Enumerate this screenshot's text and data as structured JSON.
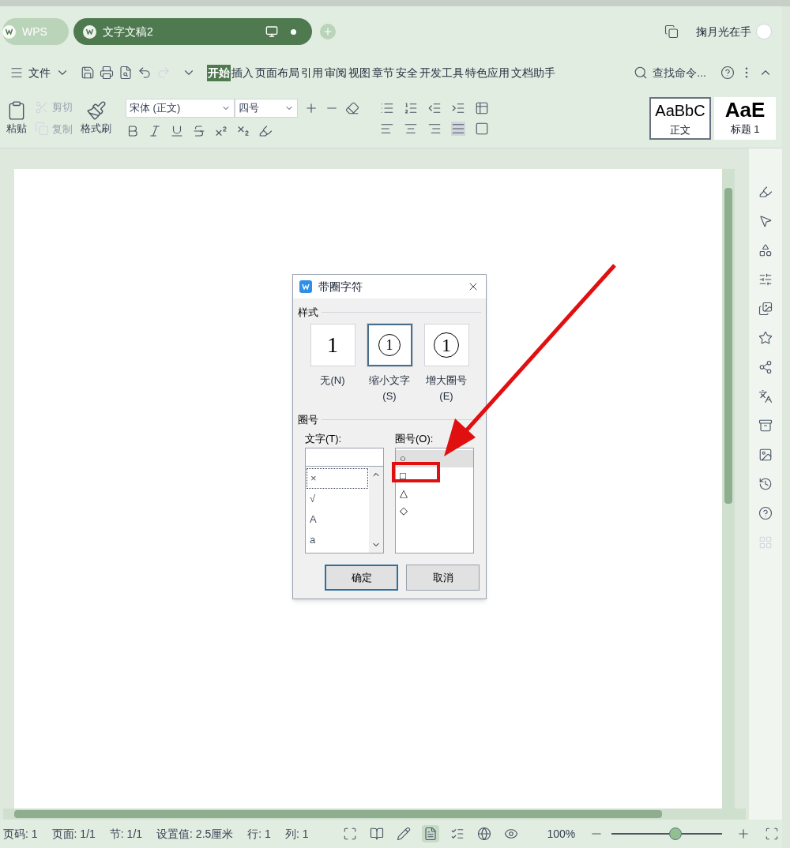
{
  "app_tabs": [
    {
      "label": "WPS",
      "selected": false
    },
    {
      "label": "文字文稿2",
      "selected": true
    }
  ],
  "user": "掬月光在手",
  "menu": {
    "file": "文件",
    "tabs": [
      {
        "label": "开始",
        "selected": true
      },
      {
        "label": "插入",
        "selected": false
      },
      {
        "label": "页面布局",
        "selected": false
      },
      {
        "label": "引用",
        "selected": false
      },
      {
        "label": "审阅",
        "selected": false
      },
      {
        "label": "视图",
        "selected": false
      },
      {
        "label": "章节",
        "selected": false
      },
      {
        "label": "安全",
        "selected": false
      },
      {
        "label": "开发工具",
        "selected": false
      },
      {
        "label": "特色应用",
        "selected": false
      },
      {
        "label": "文档助手",
        "selected": false
      }
    ],
    "search": "查找命令..."
  },
  "ribbon": {
    "paste": "粘贴",
    "cut": {
      "label": "剪切",
      "disabled": true
    },
    "copy": {
      "label": "复制",
      "disabled": true
    },
    "format_painter": "格式刷",
    "font": "宋体 (正文)",
    "size": "四号",
    "styles": [
      {
        "preview": "AaBbC",
        "label": "正文",
        "selected": true
      },
      {
        "preview": "AaE",
        "label": "标题 1",
        "selected": false
      }
    ]
  },
  "dialog": {
    "title": "带圈字符",
    "style_section": "样式",
    "styles": [
      {
        "kind": "none",
        "preview": "1",
        "label": "无(N)",
        "selected": false
      },
      {
        "kind": "shrink",
        "preview": "1",
        "label": "缩小文字 (S)",
        "selected": true
      },
      {
        "kind": "enlarge",
        "preview": "1",
        "label": "增大圈号 (E)",
        "selected": false
      }
    ],
    "enclosure_section": "圈号",
    "text_label": "文字(T):",
    "text_items": [
      {
        "label": "×",
        "selected": true
      },
      {
        "label": "√",
        "selected": false
      },
      {
        "label": "A",
        "selected": false
      },
      {
        "label": "a",
        "selected": false
      }
    ],
    "enclosure_label": "圈号(O):",
    "enclosures": [
      {
        "label": "○",
        "selected": true
      },
      {
        "label": "□",
        "selected": false
      },
      {
        "label": "△",
        "selected": false
      },
      {
        "label": "◇",
        "selected": false
      }
    ],
    "buttons": [
      {
        "label": "确定",
        "kind": "default"
      },
      {
        "label": "取消",
        "kind": "normal"
      }
    ]
  },
  "status": [
    "页码: 1",
    "页面: 1/1",
    "节: 1/1",
    "设置值: 2.5厘米",
    "行: 1",
    "列: 1"
  ],
  "view_modes": [
    {
      "kind": "fullscreen",
      "selected": false
    },
    {
      "kind": "reading",
      "selected": false
    },
    {
      "kind": "edit",
      "selected": false
    },
    {
      "kind": "page",
      "selected": true
    },
    {
      "kind": "outline",
      "selected": false
    },
    {
      "kind": "web",
      "selected": false
    },
    {
      "kind": "eye",
      "selected": false
    }
  ],
  "zoom": {
    "reading": "100%",
    "level": 0.58
  }
}
